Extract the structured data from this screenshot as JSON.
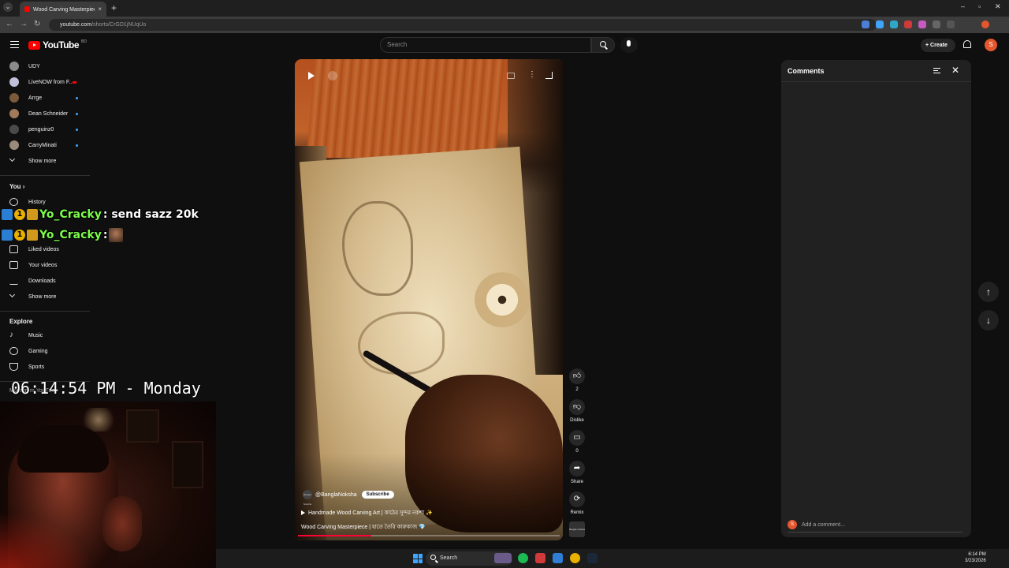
{
  "browser": {
    "tab_title": "Wood Carving Masterpiece | 'শ'",
    "tab_close": "×",
    "new_tab": "+",
    "url_host": "youtube.com",
    "url_path": "/shorts/CrGD1jNUqUo"
  },
  "header": {
    "logo_text": "YouTube",
    "country_code": "BD",
    "search_placeholder": "Search",
    "create_label": "Create",
    "avatar_letter": "S"
  },
  "sidebar": {
    "subscriptions": [
      {
        "label": "UDY"
      },
      {
        "label": "LiveNOW from F..."
      },
      {
        "label": "Arrge"
      },
      {
        "label": "Dean Schneider"
      },
      {
        "label": "penguinz0"
      },
      {
        "label": "CarryMinati"
      }
    ],
    "show_more_1": "Show more",
    "you_heading": "You",
    "you_items": [
      {
        "label": "History"
      },
      {
        "label": "Liked videos"
      },
      {
        "label": "Your videos"
      },
      {
        "label": "Downloads"
      }
    ],
    "show_more_2": "Show more",
    "explore_heading": "Explore",
    "explore_items": [
      {
        "label": "Music"
      },
      {
        "label": "Gaming"
      },
      {
        "label": "Sports"
      }
    ],
    "more_from_youtube": "More from YouTube"
  },
  "overlay": {
    "chat": [
      {
        "user": "Yo_Cracky",
        "message": ": send sazz 20k"
      },
      {
        "user": "Yo_Cracky",
        "message": ":"
      }
    ],
    "badge_number": "1",
    "clock": "06:14:54 PM - Monday"
  },
  "video": {
    "channel_handle": "@BanglaNoksha",
    "channel_avatar_text": "Bangla Noksha",
    "subscribe_label": "Subscribe",
    "title_line1": "Handmade Wood Carving Art | কাঠের সুন্দর নকশা ✨",
    "title_line2": "Wood Carving Masterpiece | হাতে তৈরি কারুকাজ 💎",
    "progress": 0.28
  },
  "actions": {
    "like_count": "2",
    "dislike_label": "Dislike",
    "comment_count": "0",
    "share_label": "Share",
    "remix_label": "Remix",
    "sound_thumb_text": "Bangla noksha"
  },
  "comments": {
    "title": "Comments",
    "add_placeholder": "Add a comment...",
    "avatar_letter": "S"
  },
  "taskbar": {
    "search_label": "Search",
    "time": "6:14 PM",
    "date": "3/23/2026"
  },
  "colors": {
    "accent_red": "#ff0000",
    "progress_red": "#ff0033",
    "chat_name_green": "#7cfc4a",
    "bg": "#0f0f0f"
  }
}
